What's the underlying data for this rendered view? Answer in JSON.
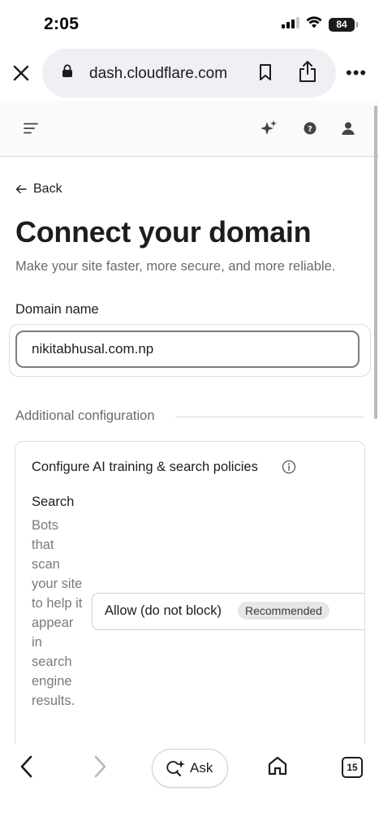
{
  "status_bar": {
    "time": "2:05",
    "battery": "84"
  },
  "browser": {
    "url": "dash.cloudflare.com",
    "more_label": "•••"
  },
  "page": {
    "back_label": "Back",
    "title": "Connect your domain",
    "subtitle": "Make your site faster, more secure, and more reliable.",
    "domain_label": "Domain name",
    "domain_value": "nikitabhusal.com.np",
    "section_heading": "Additional configuration",
    "card": {
      "title": "Configure AI training & search policies",
      "search_label": "Search",
      "search_description": "Bots that scan your site to help it appear in search engine results.",
      "policy_value": "Allow (do not block)",
      "policy_badge": "Recommended"
    }
  },
  "bottom_bar": {
    "ask_label": "Ask",
    "tab_count": "15"
  },
  "colors": {
    "text_primary": "#1d1d1f",
    "text_secondary": "#6b6b6b",
    "address_bar_bg": "#eef0f3",
    "badge_bg": "#e6e6e6"
  }
}
